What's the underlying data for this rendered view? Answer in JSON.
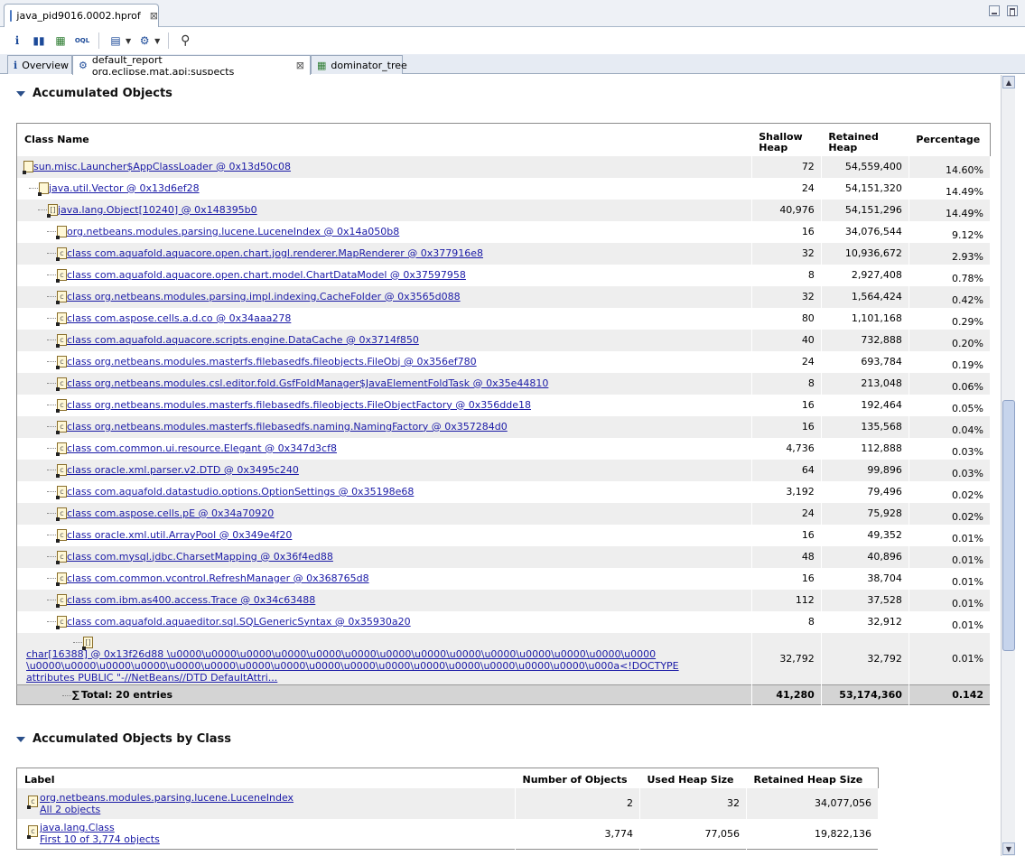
{
  "editor_tab": {
    "title": "java_pid9016.0002.hprof"
  },
  "toolbar": {
    "buttons": [
      "info-icon",
      "histogram-icon",
      "dominator-tree-icon",
      "oql-icon",
      "reports-icon",
      "query-browser-icon",
      "search-icon"
    ]
  },
  "inner_tabs": [
    {
      "label": "Overview"
    },
    {
      "label": "default_report  org.eclipse.mat.api:suspects"
    },
    {
      "label": "dominator_tree"
    }
  ],
  "section1": {
    "title": "Accumulated Objects",
    "headers": {
      "class_name": "Class Name",
      "shallow": "Shallow Heap",
      "retained": "Retained Heap",
      "percentage": "Percentage"
    },
    "rows": [
      {
        "name": "sun.misc.Launcher$AppClassLoader @ 0x13d50c08",
        "shallow": "72",
        "retained": "54,559,400",
        "pct": "14.60%"
      },
      {
        "name": "java.util.Vector @ 0x13d6ef28",
        "shallow": "24",
        "retained": "54,151,320",
        "pct": "14.49%"
      },
      {
        "name": "java.lang.Object[10240] @ 0x148395b0",
        "shallow": "40,976",
        "retained": "54,151,296",
        "pct": "14.49%"
      },
      {
        "name": "org.netbeans.modules.parsing.lucene.LuceneIndex @ 0x14a050b8",
        "shallow": "16",
        "retained": "34,076,544",
        "pct": "9.12%"
      },
      {
        "name": "class com.aquafold.aquacore.open.chart.jogl.renderer.MapRenderer @ 0x377916e8",
        "shallow": "32",
        "retained": "10,936,672",
        "pct": "2.93%"
      },
      {
        "name": "class com.aquafold.aquacore.open.chart.model.ChartDataModel @ 0x37597958",
        "shallow": "8",
        "retained": "2,927,408",
        "pct": "0.78%"
      },
      {
        "name": "class org.netbeans.modules.parsing.impl.indexing.CacheFolder @ 0x3565d088",
        "shallow": "32",
        "retained": "1,564,424",
        "pct": "0.42%"
      },
      {
        "name": "class com.aspose.cells.a.d.co @ 0x34aaa278",
        "shallow": "80",
        "retained": "1,101,168",
        "pct": "0.29%"
      },
      {
        "name": "class com.aquafold.aquacore.scripts.engine.DataCache @ 0x3714f850",
        "shallow": "40",
        "retained": "732,888",
        "pct": "0.20%"
      },
      {
        "name": "class org.netbeans.modules.masterfs.filebasedfs.fileobjects.FileObj @ 0x356ef780",
        "shallow": "24",
        "retained": "693,784",
        "pct": "0.19%"
      },
      {
        "name": "class org.netbeans.modules.csl.editor.fold.GsfFoldManager$JavaElementFoldTask @ 0x35e44810",
        "shallow": "8",
        "retained": "213,048",
        "pct": "0.06%"
      },
      {
        "name": "class org.netbeans.modules.masterfs.filebasedfs.fileobjects.FileObjectFactory @ 0x356dde18",
        "shallow": "16",
        "retained": "192,464",
        "pct": "0.05%"
      },
      {
        "name": "class org.netbeans.modules.masterfs.filebasedfs.naming.NamingFactory @ 0x357284d0",
        "shallow": "16",
        "retained": "135,568",
        "pct": "0.04%"
      },
      {
        "name": "class com.common.ui.resource.Elegant @ 0x347d3cf8",
        "shallow": "4,736",
        "retained": "112,888",
        "pct": "0.03%"
      },
      {
        "name": "class oracle.xml.parser.v2.DTD @ 0x3495c240",
        "shallow": "64",
        "retained": "99,896",
        "pct": "0.03%"
      },
      {
        "name": "class com.aquafold.datastudio.options.OptionSettings @ 0x35198e68",
        "shallow": "3,192",
        "retained": "79,496",
        "pct": "0.02%"
      },
      {
        "name": "class com.aspose.cells.pE @ 0x34a70920",
        "shallow": "24",
        "retained": "75,928",
        "pct": "0.02%"
      },
      {
        "name": "class oracle.xml.util.ArrayPool @ 0x349e4f20",
        "shallow": "16",
        "retained": "49,352",
        "pct": "0.01%"
      },
      {
        "name": "class com.mysql.jdbc.CharsetMapping @ 0x36f4ed88",
        "shallow": "48",
        "retained": "40,896",
        "pct": "0.01%"
      },
      {
        "name": "class com.common.vcontrol.RefreshManager @ 0x368765d8",
        "shallow": "16",
        "retained": "38,704",
        "pct": "0.01%"
      },
      {
        "name": "class com.ibm.as400.access.Trace @ 0x34c63488",
        "shallow": "112",
        "retained": "37,528",
        "pct": "0.01%"
      },
      {
        "name": "class com.aquafold.aquaeditor.sql.SQLGenericSyntax @ 0x35930a20",
        "shallow": "8",
        "retained": "32,912",
        "pct": "0.01%"
      }
    ],
    "char_row": {
      "line1": "char[16388] @ 0x13f26d88 \\u0000\\u0000\\u0000\\u0000\\u0000\\u0000\\u0000\\u0000\\u0000\\u0000\\u0000\\u0000\\u0000\\u0000",
      "line2": "\\u0000\\u0000\\u0000\\u0000\\u0000\\u0000\\u0000\\u0000\\u0000\\u0000\\u0000\\u0000\\u0000\\u0000\\u0000\\u0000\\u000a<!DOCTYPE",
      "line3": "attributes PUBLIC \"-//NetBeans//DTD DefaultAttri...",
      "shallow": "32,792",
      "retained": "32,792",
      "pct": "0.01%"
    },
    "total": {
      "label": "Total: 20 entries",
      "shallow": "41,280",
      "retained": "53,174,360",
      "pct": "0.142"
    }
  },
  "section2": {
    "title": "Accumulated Objects by Class",
    "headers": {
      "label": "Label",
      "num": "Number of Objects",
      "used": "Used Heap Size",
      "retained": "Retained Heap Size"
    },
    "rows": [
      {
        "label": "org.netbeans.modules.parsing.lucene.LuceneIndex",
        "sub": "All 2 objects",
        "num": "2",
        "used": "32",
        "retained": "34,077,056"
      },
      {
        "label": "java.lang.Class",
        "sub": "First 10 of 3,774 objects",
        "num": "3,774",
        "used": "77,056",
        "retained": "19,822,136"
      }
    ]
  }
}
